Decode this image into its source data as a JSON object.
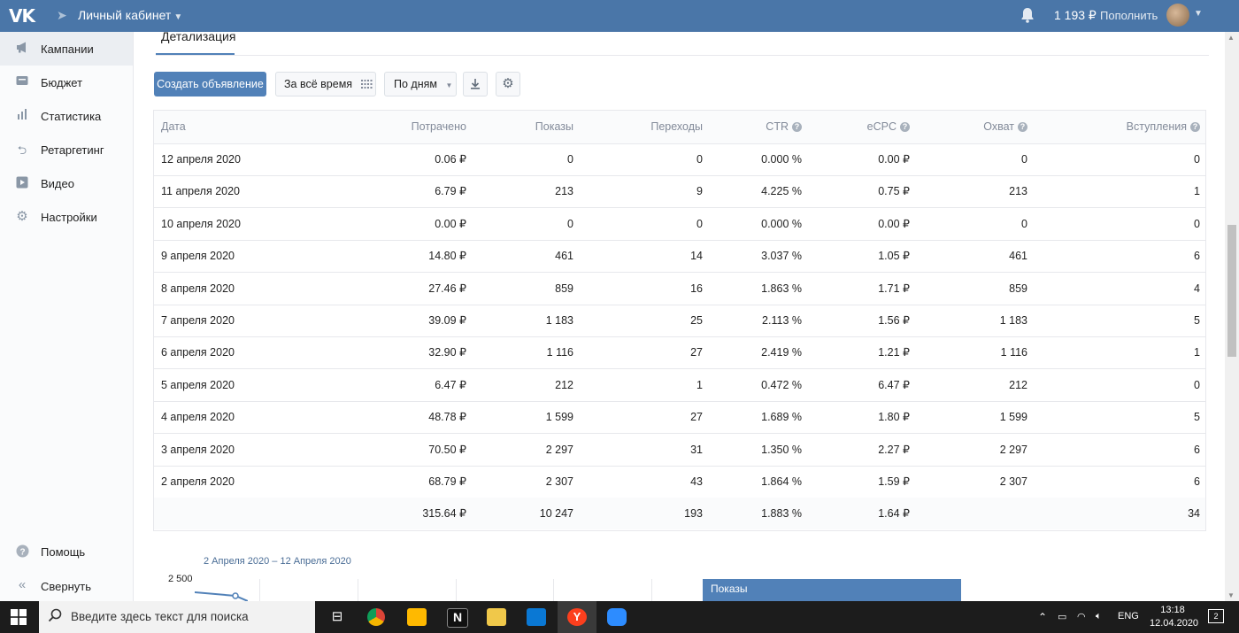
{
  "topbar": {
    "logo": "VK",
    "cabinet_label": "Личный кабинет",
    "balance": "1 193 ₽",
    "topup_label": "Пополнить"
  },
  "sidebar": {
    "items": [
      {
        "label": "Кампании",
        "icon": "megaphone-icon",
        "active": true
      },
      {
        "label": "Бюджет",
        "icon": "wallet-icon",
        "active": false
      },
      {
        "label": "Статистика",
        "icon": "bar-chart-icon",
        "active": false
      },
      {
        "label": "Ретаргетинг",
        "icon": "retarget-icon",
        "active": false
      },
      {
        "label": "Видео",
        "icon": "video-icon",
        "active": false
      },
      {
        "label": "Настройки",
        "icon": "gear-icon",
        "active": false
      }
    ],
    "help_label": "Помощь",
    "collapse_label": "Свернуть"
  },
  "main": {
    "tab_label": "Детализация",
    "toolbar": {
      "create_label": "Создать объявление",
      "period_label": "За всё время",
      "grouping_label": "По дням"
    },
    "table": {
      "headers": [
        "Дата",
        "Потрачено",
        "Показы",
        "Переходы",
        "CTR",
        "eCPC",
        "Охват",
        "Вступления"
      ],
      "rows": [
        [
          "12 апреля 2020",
          "0.06 ₽",
          "0",
          "0",
          "0.000 %",
          "0.00 ₽",
          "0",
          "0"
        ],
        [
          "11 апреля 2020",
          "6.79 ₽",
          "213",
          "9",
          "4.225 %",
          "0.75 ₽",
          "213",
          "1"
        ],
        [
          "10 апреля 2020",
          "0.00 ₽",
          "0",
          "0",
          "0.000 %",
          "0.00 ₽",
          "0",
          "0"
        ],
        [
          "9 апреля 2020",
          "14.80 ₽",
          "461",
          "14",
          "3.037 %",
          "1.05 ₽",
          "461",
          "6"
        ],
        [
          "8 апреля 2020",
          "27.46 ₽",
          "859",
          "16",
          "1.863 %",
          "1.71 ₽",
          "859",
          "4"
        ],
        [
          "7 апреля 2020",
          "39.09 ₽",
          "1 183",
          "25",
          "2.113 %",
          "1.56 ₽",
          "1 183",
          "5"
        ],
        [
          "6 апреля 2020",
          "32.90 ₽",
          "1 116",
          "27",
          "2.419 %",
          "1.21 ₽",
          "1 116",
          "1"
        ],
        [
          "5 апреля 2020",
          "6.47 ₽",
          "212",
          "1",
          "0.472 %",
          "6.47 ₽",
          "212",
          "0"
        ],
        [
          "4 апреля 2020",
          "48.78 ₽",
          "1 599",
          "27",
          "1.689 %",
          "1.80 ₽",
          "1 599",
          "5"
        ],
        [
          "3 апреля 2020",
          "70.50 ₽",
          "2 297",
          "31",
          "1.350 %",
          "2.27 ₽",
          "2 297",
          "6"
        ],
        [
          "2 апреля 2020",
          "68.79 ₽",
          "2 307",
          "43",
          "1.864 %",
          "1.59 ₽",
          "2 307",
          "6"
        ]
      ],
      "totals": [
        "",
        "315.64 ₽",
        "10 247",
        "193",
        "1.883 %",
        "1.64 ₽",
        "",
        "34"
      ]
    },
    "chart": {
      "date_range": "2 Апреля 2020 – 12 Апреля 2020",
      "y_tick": "2 500",
      "legend_label": "Показы"
    }
  },
  "taskbar": {
    "search_placeholder": "Введите здесь текст для поиска",
    "language": "ENG",
    "time": "13:18",
    "date": "12.04.2020",
    "notifications": "2"
  }
}
